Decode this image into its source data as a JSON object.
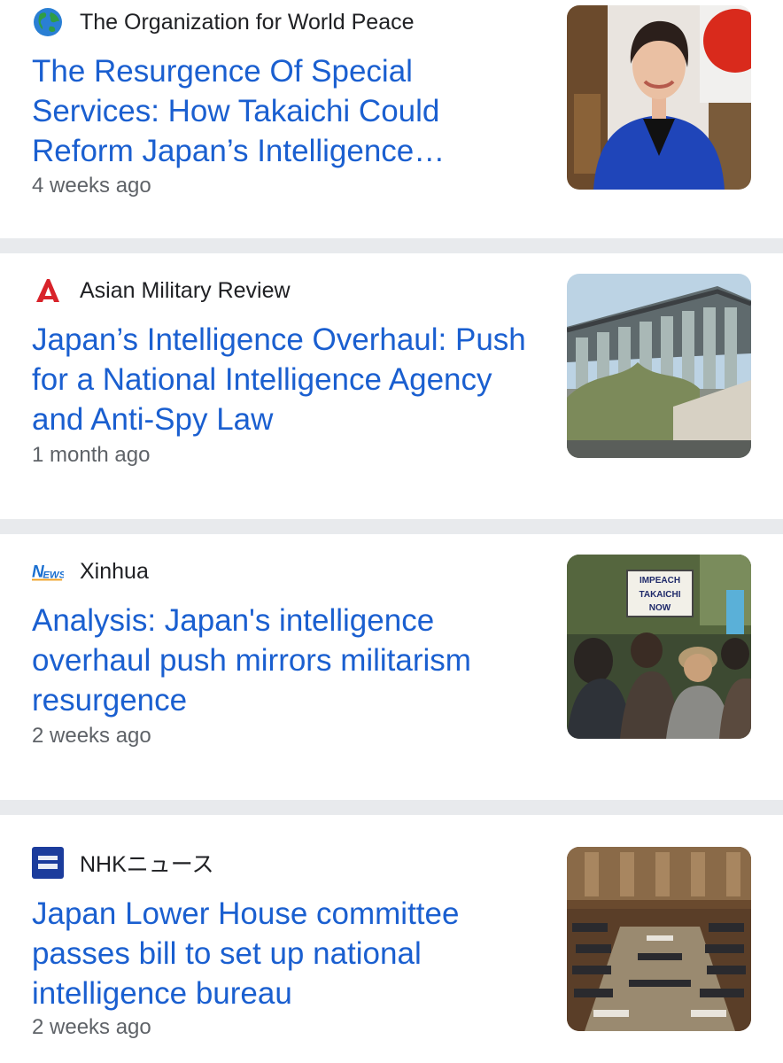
{
  "articles": [
    {
      "source": "The Organization for World Peace",
      "source_icon": "globe-icon",
      "headline": "The Resurgence Of Special Services: How Takaichi Could Reform Japan’s Intelligence…",
      "time": "4 weeks ago",
      "thumbnail": "woman-portrait-thumbnail"
    },
    {
      "source": "Asian Military Review",
      "source_icon": "letter-a-logo-icon",
      "headline": "Japan’s Intelligence Overhaul: Push for a National Intelligence Agency and Anti-Spy Law",
      "time": "1 month ago",
      "thumbnail": "building-thumbnail"
    },
    {
      "source": "Xinhua",
      "source_icon": "news-logo-icon",
      "headline": "Analysis: Japan's intelligence overhaul push mirrors militarism resurgence",
      "time": "2 weeks ago",
      "thumbnail": "protest-thumbnail",
      "sign_text": "IMPEACH TAKAICHI NOW"
    },
    {
      "source": "NHKニュース",
      "source_icon": "nhk-logo-icon",
      "headline": "Japan Lower House committee passes bill to set up national intelligence bureau",
      "time": "2 weeks ago",
      "thumbnail": "parliament-thumbnail"
    }
  ],
  "colors": {
    "headline": "#1a5fd0",
    "source": "#202124",
    "time": "#5f6368",
    "divider": "#e8eaed",
    "asian_military_review_logo": "#d8232a",
    "nhk_logo": "#1b3c9c"
  }
}
